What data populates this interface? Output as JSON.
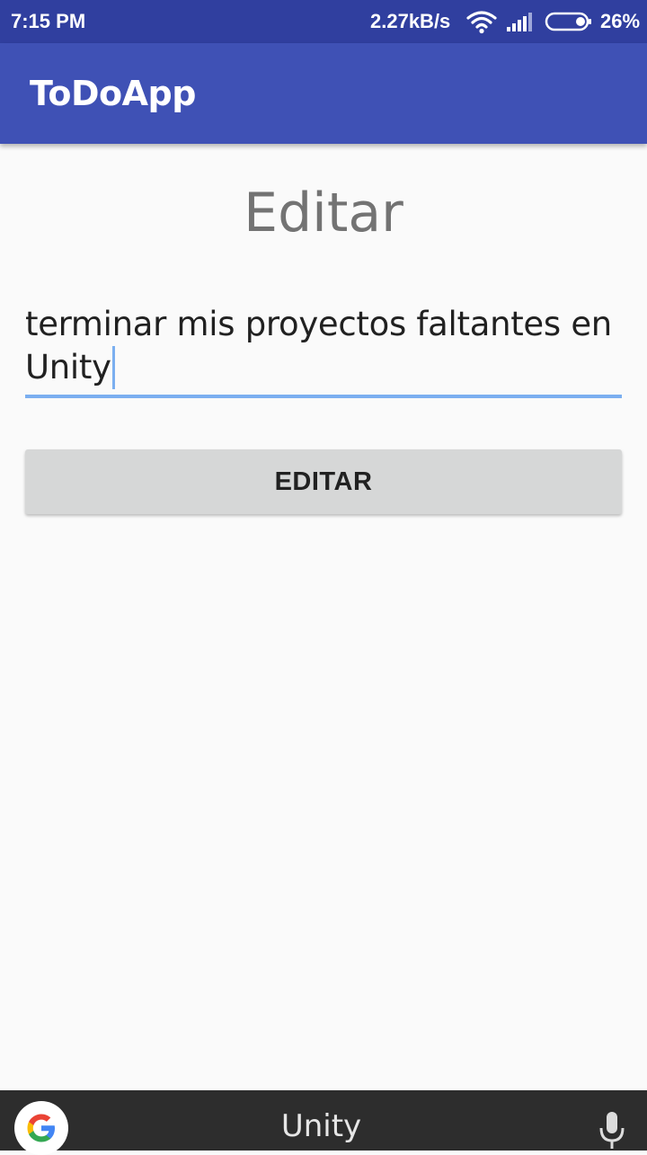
{
  "status_bar": {
    "time": "7:15 PM",
    "network_speed": "2.27kB/s",
    "battery_percent": "26%",
    "battery_level": 0.26,
    "icons": [
      "wifi-icon",
      "signal-icon",
      "battery-icon"
    ]
  },
  "app_bar": {
    "title": "ToDoApp"
  },
  "screen": {
    "heading": "Editar",
    "task_field": {
      "value": "terminar mis proyectos faltantes en Unity"
    },
    "edit_button": {
      "label": "EDITAR"
    }
  },
  "bottom_bar": {
    "query": "Unity",
    "icons": [
      "google-icon",
      "mic-icon"
    ]
  },
  "colors": {
    "status_bar": "#303f9f",
    "app_bar": "#3f51b5",
    "accent_underline": "#7baff0",
    "button": "#d6d7d7",
    "background": "#fafafa"
  }
}
